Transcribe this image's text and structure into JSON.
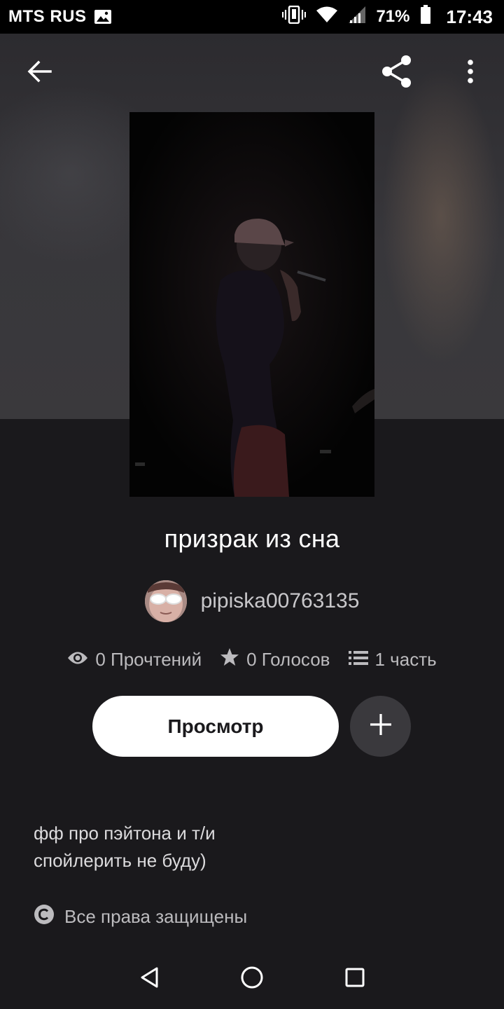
{
  "status_bar": {
    "carrier": "MTS RUS",
    "battery_percent": "71%",
    "time": "17:43",
    "icons": [
      "image-notification-icon",
      "vibrate-icon",
      "wifi-icon",
      "signal-icon",
      "battery-icon"
    ]
  },
  "toolbar": {
    "icons": [
      "back-arrow-icon",
      "share-icon",
      "more-vert-icon"
    ]
  },
  "story": {
    "title": "призрак из сна",
    "author": "pipiska00763135",
    "stats": {
      "reads": "0 Прочтений",
      "votes": "0 Голосов",
      "parts": "1 часть"
    },
    "view_button": "Просмотр",
    "description_lines": [
      "фф про пэйтона и т/и",
      "спойлерить не буду)"
    ],
    "copyright": "Все права защищены"
  },
  "nav_bar": {
    "icons": [
      "back-triangle-icon",
      "home-circle-icon",
      "recents-square-icon"
    ]
  },
  "colors": {
    "background": "#1a191c",
    "header_backdrop": "#38373b",
    "button_white": "#ffffff",
    "add_button": "#3a393d",
    "text_secondary": "#bcbbbe"
  }
}
